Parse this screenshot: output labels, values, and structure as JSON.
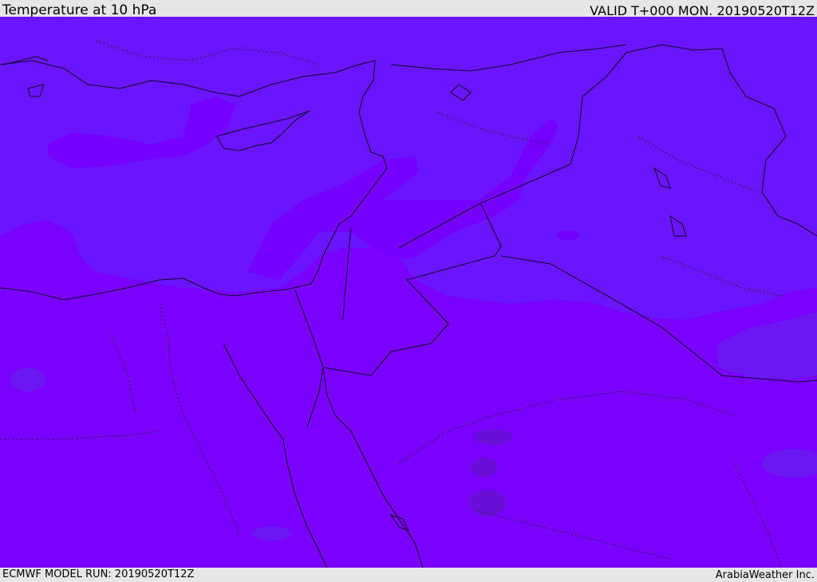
{
  "header": {
    "title": "Temperature at 10 hPa",
    "valid_time": "VALID T+000 MON. 20190520T12Z"
  },
  "footer": {
    "model_run": "ECMWF MODEL RUN: 20190520T12Z",
    "credit": "ArabiaWeather Inc."
  },
  "colors": {
    "warm_field": "#7a00ff",
    "mid_field": "#6a14ff",
    "cool_field": "#6b18f0",
    "cold_patch": "#6a0fd8",
    "border": "#0a0a2a"
  }
}
